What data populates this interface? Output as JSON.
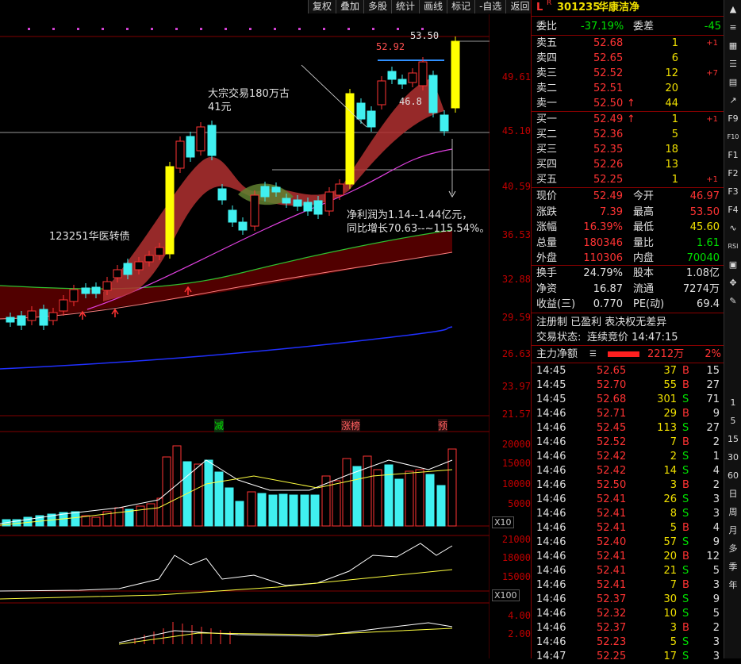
{
  "toolbar": {
    "items": [
      "复权",
      "叠加",
      "多股",
      "统计",
      "画线",
      "标记",
      "-自选",
      "返回"
    ]
  },
  "stock": {
    "flag_l": "L",
    "flag_r": "R",
    "code": "301235",
    "name": "华康洁净"
  },
  "order_ratio": {
    "label1": "委比",
    "value1": "-37.19%",
    "label2": "委差",
    "value2": "-45"
  },
  "asks": [
    {
      "label": "卖五",
      "price": "52.68",
      "vol": "1",
      "chg": "+1"
    },
    {
      "label": "卖四",
      "price": "52.65",
      "vol": "6",
      "chg": ""
    },
    {
      "label": "卖三",
      "price": "52.52",
      "vol": "12",
      "chg": "+7"
    },
    {
      "label": "卖二",
      "price": "52.51",
      "vol": "20",
      "chg": ""
    },
    {
      "label": "卖一",
      "price": "52.50",
      "vol": "44",
      "chg": "",
      "arrow": "↑"
    }
  ],
  "bids": [
    {
      "label": "买一",
      "price": "52.49",
      "vol": "1",
      "chg": "+1",
      "arrow": "↑"
    },
    {
      "label": "买二",
      "price": "52.36",
      "vol": "5",
      "chg": ""
    },
    {
      "label": "买三",
      "price": "52.35",
      "vol": "18",
      "chg": ""
    },
    {
      "label": "买四",
      "price": "52.26",
      "vol": "13",
      "chg": ""
    },
    {
      "label": "买五",
      "price": "52.25",
      "vol": "1",
      "chg": "+1"
    }
  ],
  "quote": [
    {
      "l1": "现价",
      "v1": "52.49",
      "l2": "今开",
      "v2": "46.97"
    },
    {
      "l1": "涨跌",
      "v1": "7.39",
      "l2": "最高",
      "v2": "53.50"
    },
    {
      "l1": "涨幅",
      "v1": "16.39%",
      "l2": "最低",
      "v2": "45.60"
    },
    {
      "l1": "总量",
      "v1": "180346",
      "l2": "量比",
      "v2": "1.61"
    },
    {
      "l1": "外盘",
      "v1": "110306",
      "l2": "内盘",
      "v2": "70040"
    }
  ],
  "fundamentals": [
    {
      "l1": "换手",
      "v1": "24.79%",
      "l2": "股本",
      "v2": "1.08亿"
    },
    {
      "l1": "净资",
      "v1": "16.87",
      "l2": "流通",
      "v2": "7274万"
    },
    {
      "l1": "收益(三)",
      "v1": "0.770",
      "l2": "PE(动)",
      "v2": "69.4"
    }
  ],
  "status_line": "注册制 已盈利 表决权无差异",
  "trade_status": {
    "label": "交易状态:",
    "value": "连续竞价 14:47:15"
  },
  "main_flow": {
    "label": "主力净额",
    "value": "2212万",
    "pct": "2%"
  },
  "ticks": [
    {
      "t": "14:45",
      "p": "52.65",
      "v": "37",
      "s": "B",
      "n": "15"
    },
    {
      "t": "14:45",
      "p": "52.70",
      "v": "55",
      "s": "B",
      "n": "27"
    },
    {
      "t": "14:45",
      "p": "52.68",
      "v": "301",
      "s": "S",
      "n": "71"
    },
    {
      "t": "14:46",
      "p": "52.71",
      "v": "29",
      "s": "B",
      "n": "9"
    },
    {
      "t": "14:46",
      "p": "52.45",
      "v": "113",
      "s": "S",
      "n": "27"
    },
    {
      "t": "14:46",
      "p": "52.52",
      "v": "7",
      "s": "B",
      "n": "2"
    },
    {
      "t": "14:46",
      "p": "52.42",
      "v": "2",
      "s": "S",
      "n": "1"
    },
    {
      "t": "14:46",
      "p": "52.42",
      "v": "14",
      "s": "S",
      "n": "4"
    },
    {
      "t": "14:46",
      "p": "52.50",
      "v": "3",
      "s": "B",
      "n": "2"
    },
    {
      "t": "14:46",
      "p": "52.41",
      "v": "26",
      "s": "S",
      "n": "3"
    },
    {
      "t": "14:46",
      "p": "52.41",
      "v": "8",
      "s": "S",
      "n": "3"
    },
    {
      "t": "14:46",
      "p": "52.41",
      "v": "5",
      "s": "B",
      "n": "4"
    },
    {
      "t": "14:46",
      "p": "52.40",
      "v": "57",
      "s": "S",
      "n": "9"
    },
    {
      "t": "14:46",
      "p": "52.41",
      "v": "20",
      "s": "B",
      "n": "12"
    },
    {
      "t": "14:46",
      "p": "52.41",
      "v": "21",
      "s": "S",
      "n": "5"
    },
    {
      "t": "14:46",
      "p": "52.41",
      "v": "7",
      "s": "B",
      "n": "3"
    },
    {
      "t": "14:46",
      "p": "52.37",
      "v": "30",
      "s": "S",
      "n": "9"
    },
    {
      "t": "14:46",
      "p": "52.32",
      "v": "10",
      "s": "S",
      "n": "5"
    },
    {
      "t": "14:46",
      "p": "52.37",
      "v": "3",
      "s": "B",
      "n": "2"
    },
    {
      "t": "14:46",
      "p": "52.23",
      "v": "5",
      "s": "S",
      "n": "3"
    },
    {
      "t": "14:47",
      "p": "52.25",
      "v": "17",
      "s": "S",
      "n": "3"
    }
  ],
  "sidebar": [
    "1",
    "5",
    "15",
    "30",
    "60",
    "日",
    "周",
    "月",
    "多",
    "季",
    "年"
  ],
  "chart_labels": {
    "price_axis": [
      "49.61",
      "45.10",
      "40.59",
      "36.53",
      "32.88",
      "29.59",
      "26.63",
      "23.97",
      "21.57"
    ],
    "vol_axis": [
      "20000",
      "15000",
      "10000",
      "5000"
    ],
    "vol_unit": "X10",
    "ind_axis": [
      "21000",
      "18000",
      "15000"
    ],
    "ind_unit": "X100",
    "ind2_axis": [
      "4.00",
      "2.00"
    ],
    "high_mark": "53.50",
    "peak_mark": "52.92",
    "mid_mark": "46.8",
    "note1a": "大宗交易180万古",
    "note1b": "41元",
    "note2": "123251华医转债",
    "note3a": "净利润为1.14--1.44亿元，",
    "note3b": "同比增长70.63--~115.54%。",
    "tag_jian": "减",
    "tag_zb": "涨榜",
    "tag_yu": "预"
  },
  "colors": {
    "up": "#ff3333",
    "down": "#40f0f0",
    "grid": "#800000",
    "accent": "#ffff00"
  }
}
